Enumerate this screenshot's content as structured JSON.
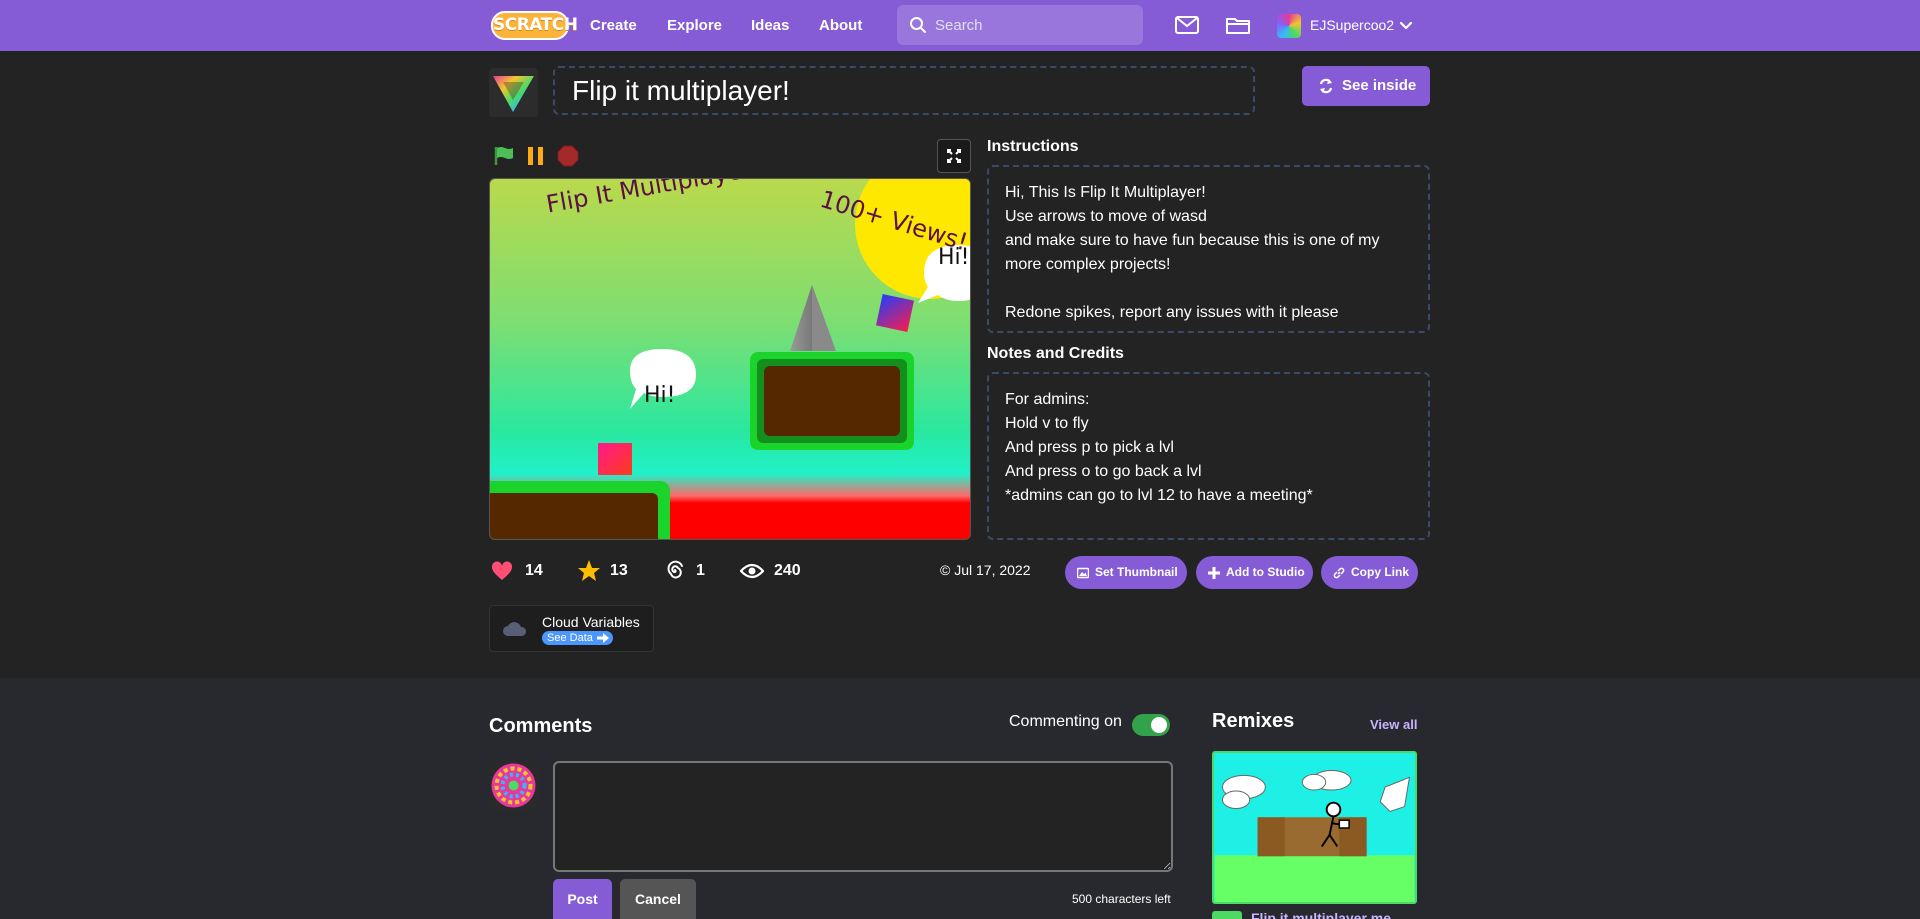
{
  "nav": {
    "logo": "SCRATCH",
    "links": [
      "Create",
      "Explore",
      "Ideas",
      "About"
    ],
    "search_placeholder": "Search",
    "username": "EJSupercoo2"
  },
  "project": {
    "title": "Flip it multiplayer!",
    "see_inside": "See inside"
  },
  "stage": {
    "title_text": "Flip It Multiplayer!",
    "views_text": "100+ Views!",
    "bubble1": "Hi!",
    "bubble2": "Hi!"
  },
  "stats": {
    "loves": "14",
    "favorites": "13",
    "remixes": "1",
    "views": "240",
    "date": "Jul 17, 2022"
  },
  "actions": {
    "set_thumbnail": "Set Thumbnail",
    "add_to_studio": "Add to Studio",
    "copy_link": "Copy Link"
  },
  "cloud": {
    "label": "Cloud Variables",
    "see_data": "See Data"
  },
  "instructions": {
    "title": "Instructions",
    "lines": [
      "Hi, This Is Flip It Multiplayer!",
      "Use arrows to move of wasd",
      "and make sure to have fun because this is one of my",
      "more complex projects!",
      "",
      "Redone spikes, report any issues with it please"
    ]
  },
  "notes": {
    "title": "Notes and Credits",
    "lines": [
      "For admins:",
      "Hold v to fly",
      "And press p to pick a lvl",
      "And press o to go back a lvl",
      "*admins can go to lvl 12 to have a meeting*"
    ]
  },
  "comments": {
    "title": "Comments",
    "commenting_label": "Commenting on",
    "commenting_enabled": true,
    "post": "Post",
    "cancel": "Cancel",
    "chars_left": "500 characters left"
  },
  "remixes": {
    "title": "Remixes",
    "view_all": "View all",
    "first_title": "Flip it multiplayer me"
  },
  "colors": {
    "nav": "#855cd6",
    "accent": "#855cd6",
    "background": "#232323",
    "lower_background": "#27292e"
  }
}
